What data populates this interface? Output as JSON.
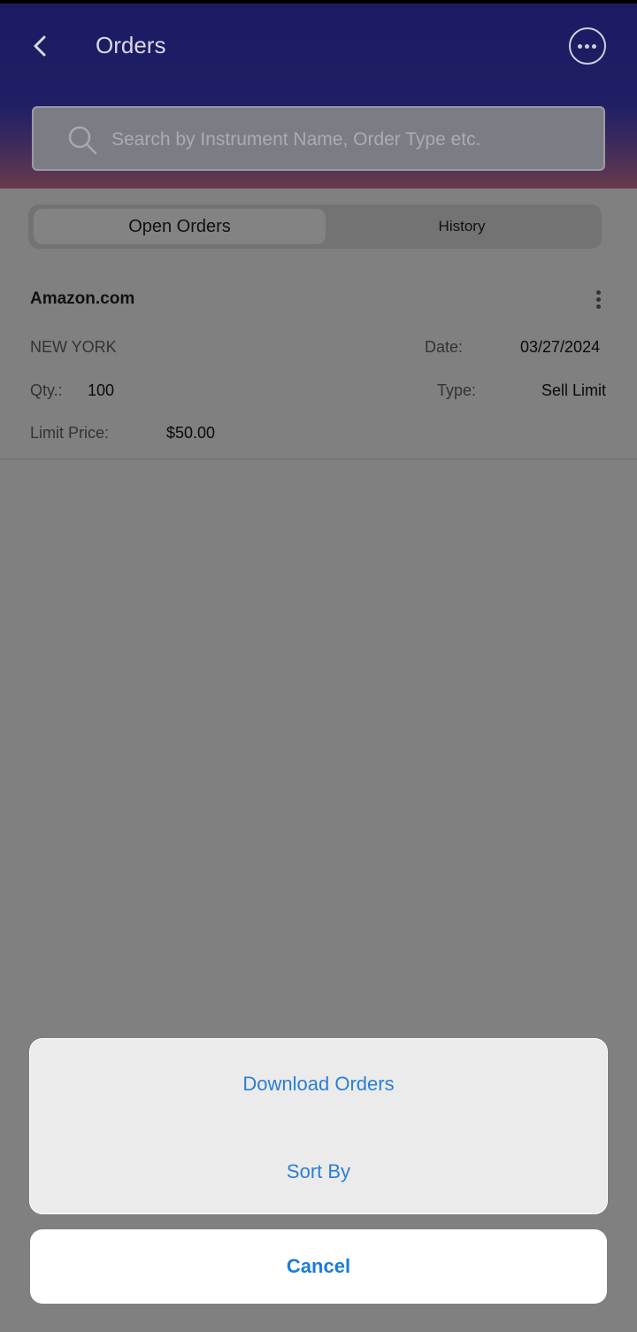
{
  "header": {
    "title": "Orders"
  },
  "search": {
    "placeholder": "Search by Instrument Name, Order Type etc."
  },
  "tabs": [
    {
      "label": "Open Orders"
    },
    {
      "label": "History"
    }
  ],
  "order": {
    "name": "Amazon.com",
    "exchange": "NEW YORK",
    "date_label": "Date:",
    "date": "03/27/2024",
    "qty_label": "Qty.:",
    "qty": "100",
    "type_label": "Type:",
    "type": "Sell Limit",
    "limit_label": "Limit Price:",
    "limit_price": "$50.00"
  },
  "sheet": {
    "options": [
      {
        "label": "Download Orders"
      },
      {
        "label": "Sort By"
      }
    ],
    "cancel": "Cancel"
  },
  "colors": {
    "accent": "#2a7fd3",
    "header": "#1f1f66"
  }
}
